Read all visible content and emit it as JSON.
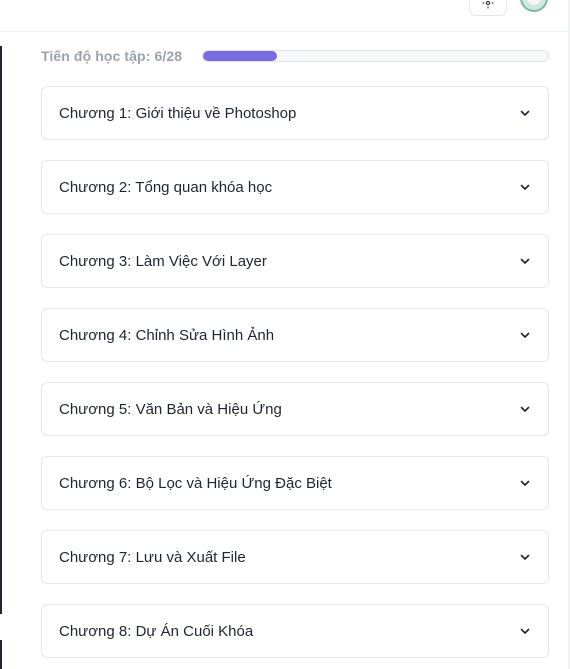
{
  "header": {
    "theme_icon": "sun-icon",
    "avatar_icon": "user-avatar-icon"
  },
  "progress": {
    "label": "Tiến độ học tập: 6/28",
    "completed": 6,
    "total": 28,
    "fraction": 0.2143,
    "color": "#7b6be0"
  },
  "chapters": [
    {
      "title": "Chương 1: Giới thiệu về Photoshop",
      "icon": "chevron-down-icon"
    },
    {
      "title": "Chương 2: Tổng quan khóa học",
      "icon": "chevron-down-icon"
    },
    {
      "title": "Chương 3: Làm Việc Với Layer",
      "icon": "chevron-down-icon"
    },
    {
      "title": "Chương 4: Chỉnh Sửa Hình Ảnh",
      "icon": "chevron-down-icon"
    },
    {
      "title": "Chương 5: Văn Bản và Hiệu Ứng",
      "icon": "chevron-down-icon"
    },
    {
      "title": "Chương 6: Bộ Lọc và Hiệu Ứng Đặc Biệt",
      "icon": "chevron-down-icon"
    },
    {
      "title": "Chương 7: Lưu và Xuất File",
      "icon": "chevron-down-icon"
    },
    {
      "title": "Chương 8: Dự Án Cuối Khóa",
      "icon": "chevron-down-icon"
    }
  ]
}
